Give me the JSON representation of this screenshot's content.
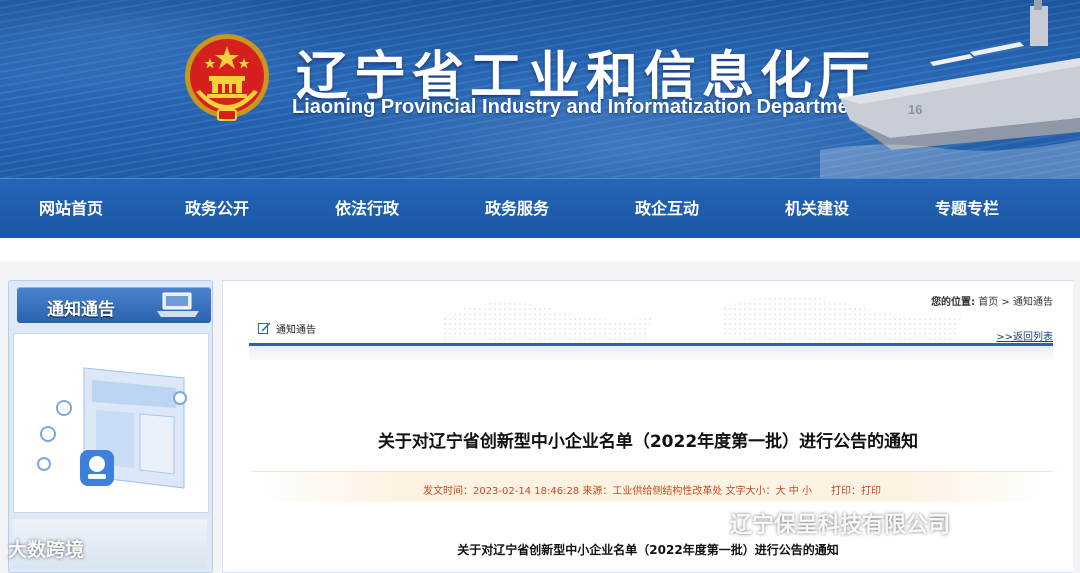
{
  "header": {
    "title_cn": "辽宁省工业和信息化厅",
    "title_en": "Liaoning Provincial Industry and Informatization Department"
  },
  "nav": {
    "items": [
      "网站首页",
      "政务公开",
      "依法行政",
      "政务服务",
      "政企互动",
      "机关建设",
      "专题专栏"
    ]
  },
  "sidebar": {
    "heading": "通知通告"
  },
  "breadcrumb": {
    "label": "您的位置:",
    "home": "首页",
    "sep": " > ",
    "current": "通知通告"
  },
  "section": {
    "label": "通知通告",
    "back_link": ">>返回列表"
  },
  "article": {
    "title": "关于对辽宁省创新型中小企业名单（2022年度第一批）进行公告的通知",
    "meta": {
      "time_label": "发文时间：",
      "time": "2023-02-14 18:46:28",
      "source_label": " 来源：",
      "source": "工业供给侧结构性改革处",
      "fontsize_label": " 文字大小：",
      "size_large": "大",
      "size_medium": "中",
      "size_small": "小",
      "print_label": "打印：",
      "print_link": "打印"
    },
    "subtitle": "关于对辽宁省创新型中小企业名单（2022年度第一批）进行公告的通知"
  },
  "watermarks": {
    "right": "辽宁保呈科技有限公司",
    "left": "大数跨境"
  },
  "colors": {
    "nav_bg": "#1e5ead",
    "accent_line": "#2b62ad",
    "meta_text": "#c94a1a"
  }
}
